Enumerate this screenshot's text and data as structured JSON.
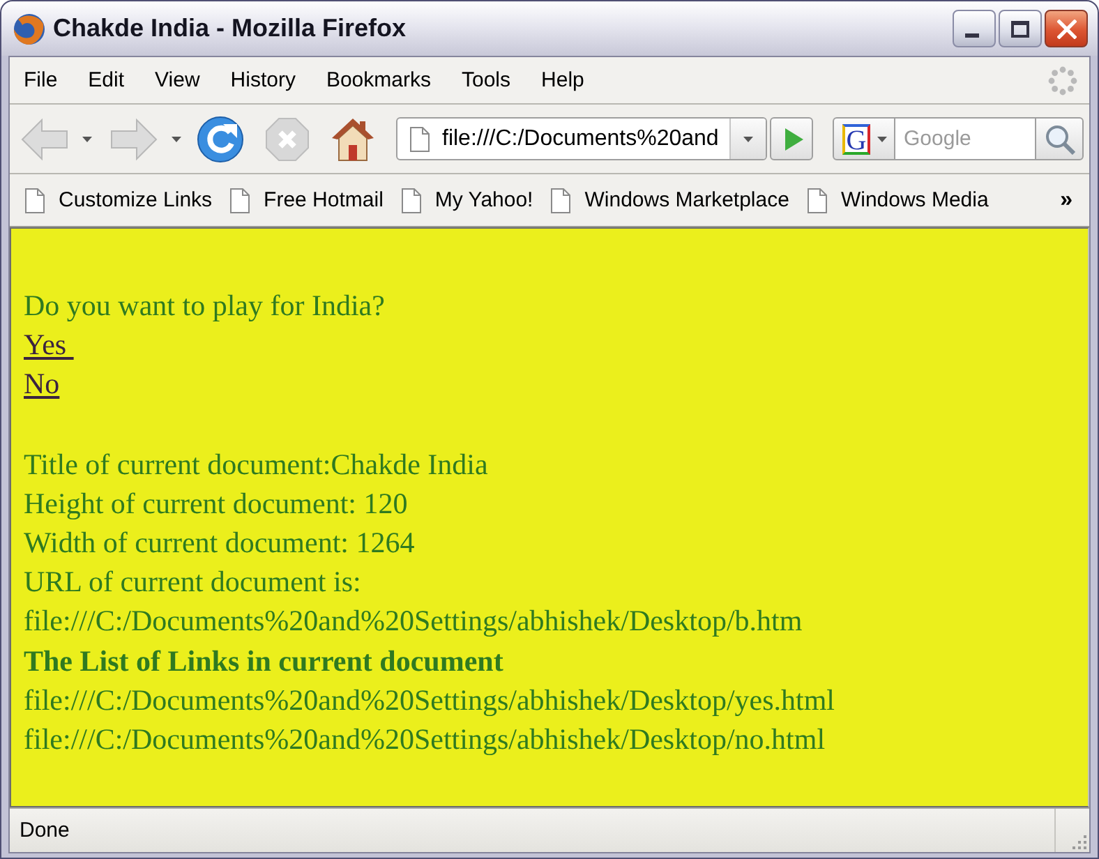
{
  "window": {
    "title": "Chakde India - Mozilla Firefox"
  },
  "menu_bar": {
    "items": [
      "File",
      "Edit",
      "View",
      "History",
      "Bookmarks",
      "Tools",
      "Help"
    ]
  },
  "navigation_toolbar": {
    "buttons": [
      {
        "kind": "back",
        "disabled": true
      },
      {
        "kind": "forward",
        "disabled": true
      },
      {
        "kind": "reload",
        "disabled": false
      },
      {
        "kind": "stop",
        "disabled": true
      },
      {
        "kind": "home",
        "disabled": false
      }
    ],
    "address": "file:///C:/Documents%20and",
    "search": {
      "engine": "G",
      "placeholder": "Google"
    }
  },
  "bookmarks_bar": {
    "items": [
      "Customize Links",
      "Free Hotmail",
      "My Yahoo!",
      "Windows Marketplace",
      "Windows Media"
    ],
    "overflow": "»"
  },
  "page": {
    "question": "Do you want to play for India?",
    "links": [
      "Yes ",
      "No"
    ],
    "details": [
      {
        "kind": "text",
        "text": "Title of current document:Chakde India"
      },
      {
        "kind": "text",
        "text": "Height of current document: 120"
      },
      {
        "kind": "text",
        "text": "Width of current document: 1264"
      },
      {
        "kind": "text",
        "text": "URL of current document is:"
      },
      {
        "kind": "url",
        "text": "file:///C:/Documents%20and%20Settings/abhishek/Desktop/b.htm"
      },
      {
        "kind": "heading",
        "text": "The List of Links in current document"
      },
      {
        "kind": "url",
        "text": "file:///C:/Documents%20and%20Settings/abhishek/Desktop/yes.html"
      },
      {
        "kind": "url",
        "text": "file:///C:/Documents%20and%20Settings/abhishek/Desktop/no.html"
      }
    ]
  },
  "status_bar": {
    "text": "Done"
  }
}
